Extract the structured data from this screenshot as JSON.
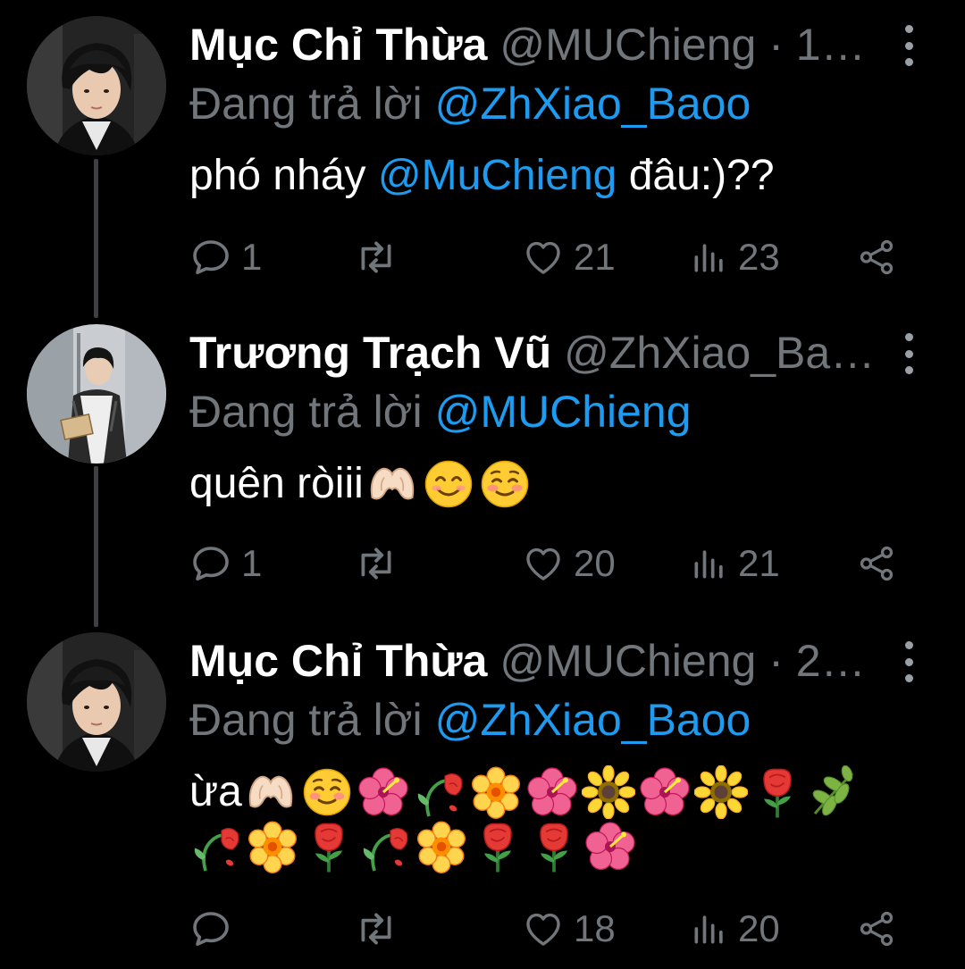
{
  "colors": {
    "background": "#000000",
    "name_text": "#ffffff",
    "muted_text": "#71767b",
    "mention": "#1d9bf0",
    "thread_line": "#3e4144"
  },
  "tweets": [
    {
      "display_name": "Mục Chỉ Thừa",
      "handle": "@MUChieng",
      "time_truncated": "· 1…",
      "reply_prefix": "Đang trả lời",
      "reply_to": "@ZhXiao_Baoo",
      "body_before": "phó nháy",
      "body_mention": "@MuChieng",
      "body_after": "đâu:)??",
      "replies": "1",
      "retweets": "",
      "likes": "21",
      "views": "23"
    },
    {
      "display_name": "Trương Trạch Vũ",
      "handle": "@ZhXiao_Ba…",
      "reply_prefix": "Đang trả lời",
      "reply_to": "@MUChieng",
      "body_text": "quên ròiii",
      "emojis": [
        "heart-hands-emoji",
        "smiling-face-emoji",
        "blushing-face-emoji"
      ],
      "replies": "1",
      "retweets": "",
      "likes": "20",
      "views": "21"
    },
    {
      "display_name": "Mục Chỉ Thừa",
      "handle": "@MUChieng",
      "time_truncated": "· 2…",
      "reply_prefix": "Đang trả lời",
      "reply_to": "@ZhXiao_Baoo",
      "body_text": "ừa",
      "emojis_line1": [
        "heart-hands-emoji",
        "blushing-face-emoji",
        "hibiscus-emoji",
        "wilted-flower-emoji",
        "blossom-emoji",
        "hibiscus-emoji",
        "sunflower-emoji",
        "hibiscus-emoji",
        "sunflower-emoji",
        "rose-emoji",
        "herb-emoji"
      ],
      "emojis_line2": [
        "wilted-flower-emoji",
        "blossom-emoji",
        "rose-emoji",
        "wilted-flower-emoji",
        "blossom-emoji",
        "rose-emoji",
        "rose-emoji",
        "hibiscus-emoji"
      ],
      "replies": "",
      "retweets": "",
      "likes": "18",
      "views": "20"
    }
  ]
}
